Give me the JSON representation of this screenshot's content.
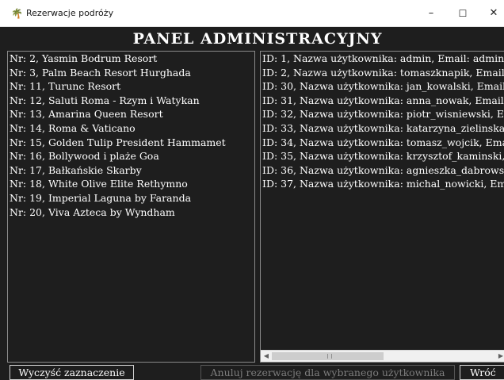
{
  "window": {
    "title": "Rezerwacje podróży",
    "controls": {
      "minimize": "–",
      "maximize": "☐",
      "close": "✕"
    },
    "app_icon": "palm-tree-icon"
  },
  "header": {
    "title": "PANEL ADMINISTRACYJNY"
  },
  "trips": [
    "Nr: 2, Yasmin Bodrum Resort",
    "Nr: 3, Palm Beach Resort Hurghada",
    "Nr: 11, Turunc Resort",
    "Nr: 12, Saluti Roma - Rzym i Watykan",
    "Nr: 13, Amarina Queen Resort",
    "Nr: 14, Roma & Vaticano",
    "Nr: 15, Golden Tulip President Hammamet",
    "Nr: 16, Bollywood i plaże Goa",
    "Nr: 17, Bałkańskie Skarby",
    "Nr: 18, White Olive Elite Rethymno",
    "Nr: 19, Imperial Laguna by Faranda",
    "Nr: 20, Viva Azteca by Wyndham"
  ],
  "users": [
    "ID: 1, Nazwa użytkownika: admin, Email: admin@",
    "ID: 2, Nazwa użytkownika: tomaszknapik, Email:",
    "ID: 30, Nazwa użytkownika: jan_kowalski, Email",
    "ID: 31, Nazwa użytkownika: anna_nowak, Email:",
    "ID: 32, Nazwa użytkownika: piotr_wisniewski, En",
    "ID: 33, Nazwa użytkownika: katarzyna_zielinska,",
    "ID: 34, Nazwa użytkownika: tomasz_wojcik, Ema",
    "ID: 35, Nazwa użytkownika: krzysztof_kaminski,",
    "ID: 36, Nazwa użytkownika: agnieszka_dabrowsk",
    "ID: 37, Nazwa użytkownika: michal_nowicki, Em"
  ],
  "scrollbar": {
    "position_fraction": 0.0,
    "visible_fraction": 0.5
  },
  "buttons": {
    "clear": "Wyczyść zaznaczenie",
    "cancel": "Anuluj rezerwację dla wybranego użytkownika",
    "back": "Wróć"
  }
}
